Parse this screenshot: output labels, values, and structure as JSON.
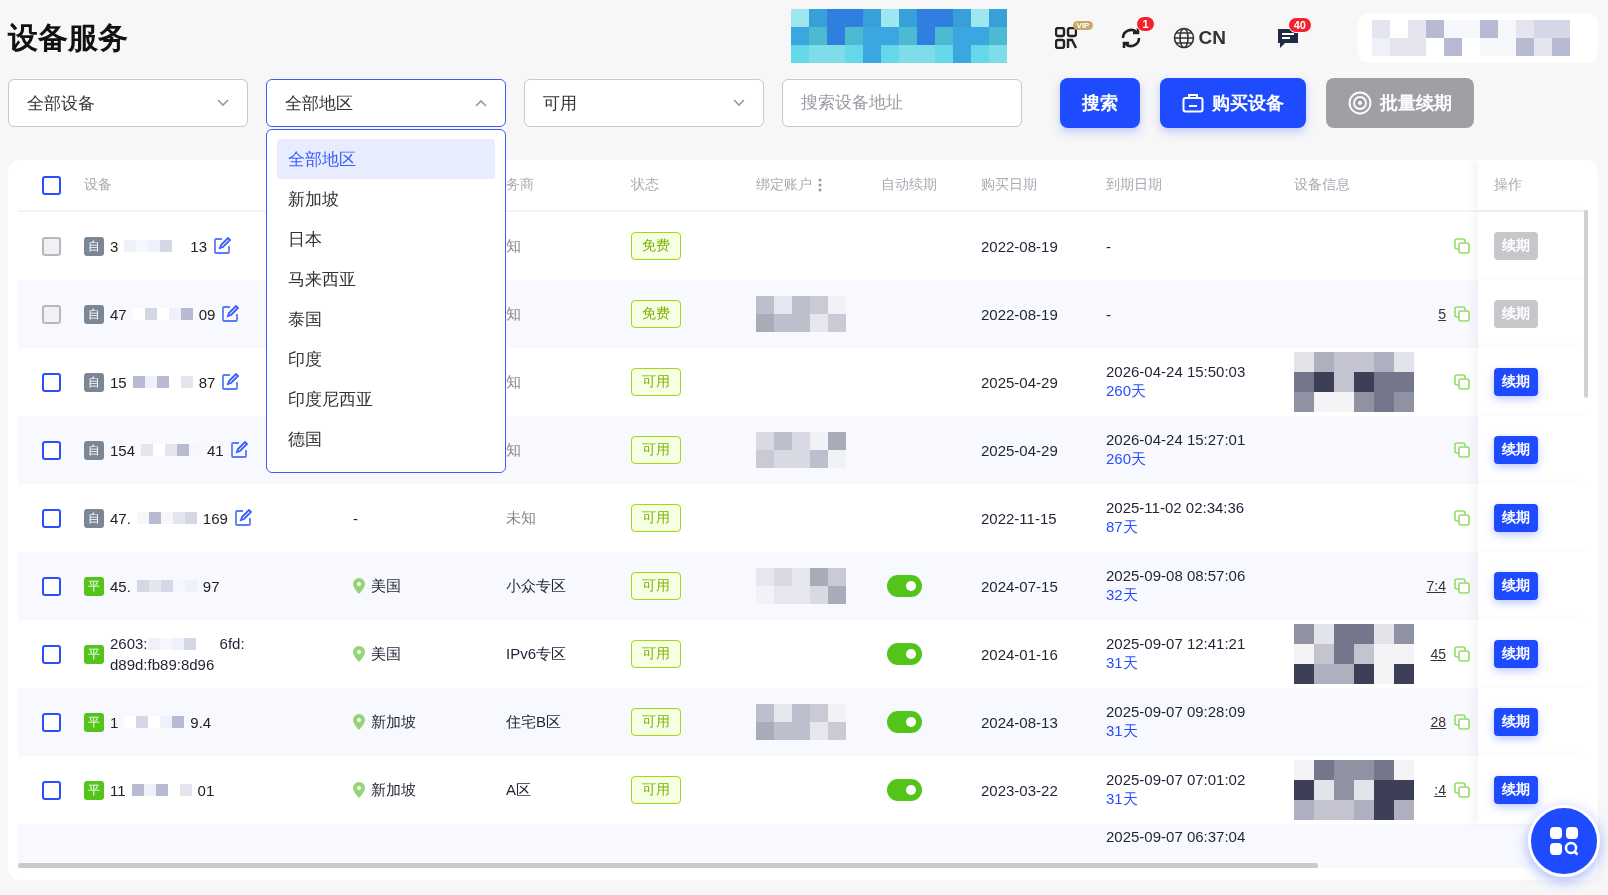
{
  "title": "设备服务",
  "header": {
    "refresh_badge": "1",
    "language": "CN",
    "message_badge": "40",
    "vip_badge": "VIP"
  },
  "filters": {
    "device_select": "全部设备",
    "region_select": {
      "value": "全部地区",
      "expanded": true
    },
    "status_select": "可用",
    "search": {
      "placeholder": "搜索设备地址"
    },
    "buttons": [
      {
        "label": "搜索",
        "kind": "search",
        "disabled": false
      },
      {
        "label": "购买设备",
        "kind": "buy",
        "disabled": false
      },
      {
        "label": "批量续期",
        "kind": "renew",
        "disabled": true
      }
    ]
  },
  "region_options": [
    {
      "label": "全部地区",
      "selected": true
    },
    {
      "label": "新加坡",
      "selected": false
    },
    {
      "label": "日本",
      "selected": false
    },
    {
      "label": "马来西亚",
      "selected": false
    },
    {
      "label": "泰国",
      "selected": false
    },
    {
      "label": "印度",
      "selected": false
    },
    {
      "label": "印度尼西亚",
      "selected": false
    },
    {
      "label": "德国",
      "selected": false
    }
  ],
  "table": {
    "select_all": {
      "checked": false
    },
    "columns": [
      "设备",
      "务商",
      "状态",
      "绑定账户",
      "自动续期",
      "购买日期",
      "到期日期",
      "设备信息",
      "操作"
    ],
    "rows": [
      {
        "disabled": true,
        "tag": {
          "text": "自",
          "color": "#7c8795"
        },
        "address_start": "3",
        "address_end": "13",
        "editable": true,
        "service": "知",
        "status": "免费",
        "account_mosaic": false,
        "purchase": "2022-08-19",
        "expire": "-",
        "info_mosaic": false,
        "renew": "续期"
      },
      {
        "disabled": true,
        "tag": {
          "text": "自",
          "color": "#7c8795"
        },
        "address_start": "47",
        "address_end": "09",
        "editable": true,
        "service": "知",
        "status": "免费",
        "account_mosaic": true,
        "purchase": "2022-08-19",
        "expire": "-",
        "info_mosaic": false,
        "info_link": "5",
        "renew": "续期"
      },
      {
        "disabled": false,
        "tag": {
          "text": "自",
          "color": "#7c8795"
        },
        "address_start": "15",
        "address_end": "87",
        "editable": true,
        "service": "知",
        "status": "可用",
        "account_mosaic": false,
        "purchase": "2025-04-29",
        "expire": "2026-04-24 15:50:03",
        "days": "260天",
        "info_mosaic": true,
        "renew": "续期"
      },
      {
        "disabled": false,
        "tag": {
          "text": "自",
          "color": "#7c8795"
        },
        "address_start": "154",
        "address_end": "41",
        "editable": true,
        "service": "知",
        "status": "可用",
        "account_mosaic": true,
        "purchase": "2025-04-29",
        "expire": "2026-04-24 15:27:01",
        "days": "260天",
        "info_mosaic": false,
        "renew": "续期"
      },
      {
        "disabled": false,
        "tag": {
          "text": "自",
          "color": "#7c8795"
        },
        "address_start": "47.",
        "address_end": "169",
        "editable": true,
        "region": "-",
        "service": "未知",
        "status": "可用",
        "account_mosaic": false,
        "purchase": "2022-11-15",
        "expire": "2025-11-02 02:34:36",
        "days": "87天",
        "info_mosaic": false,
        "renew": "续期"
      },
      {
        "disabled": false,
        "tag": {
          "text": "平",
          "color": "#52c41a"
        },
        "address_start": "45.",
        "address_end": "97",
        "editable": false,
        "region": "美国",
        "service": "小众专区",
        "status": "可用",
        "account_mosaic": true,
        "auto_renew": true,
        "purchase": "2024-07-15",
        "expire": "2025-09-08 08:57:06",
        "days": "32天",
        "info_mosaic": false,
        "info_link": "7:4",
        "renew": "续期"
      },
      {
        "disabled": false,
        "tag": {
          "text": "平",
          "color": "#52c41a"
        },
        "address_start": "2603:",
        "address_end": "6fd:",
        "address_line2": "d89d:fb89:8d96",
        "editable": false,
        "region": "美国",
        "service": "IPv6专区",
        "status": "可用",
        "account_mosaic": false,
        "auto_renew": true,
        "purchase": "2024-01-16",
        "expire": "2025-09-07 12:41:21",
        "days": "31天",
        "info_mosaic": true,
        "info_link": "45",
        "renew": "续期"
      },
      {
        "disabled": false,
        "tag": {
          "text": "平",
          "color": "#52c41a"
        },
        "address_start": "1",
        "address_end": "9.4",
        "editable": false,
        "region": "新加坡",
        "service": "住宅B区",
        "status": "可用",
        "account_mosaic": true,
        "auto_renew": true,
        "purchase": "2024-08-13",
        "expire": "2025-09-07 09:28:09",
        "days": "31天",
        "info_mosaic": false,
        "info_link": "28",
        "renew": "续期"
      },
      {
        "disabled": false,
        "tag": {
          "text": "平",
          "color": "#52c41a"
        },
        "address_start": "11",
        "address_end": "01",
        "editable": false,
        "region": "新加坡",
        "service": "A区",
        "status": "可用",
        "account_mosaic": false,
        "auto_renew": true,
        "purchase": "2023-03-22",
        "expire": "2025-09-07 07:01:02",
        "days": "31天",
        "info_mosaic": true,
        "info_link": ":4",
        "renew": "续期"
      },
      {
        "expire": "2025-09-07 06:37:04"
      }
    ]
  }
}
